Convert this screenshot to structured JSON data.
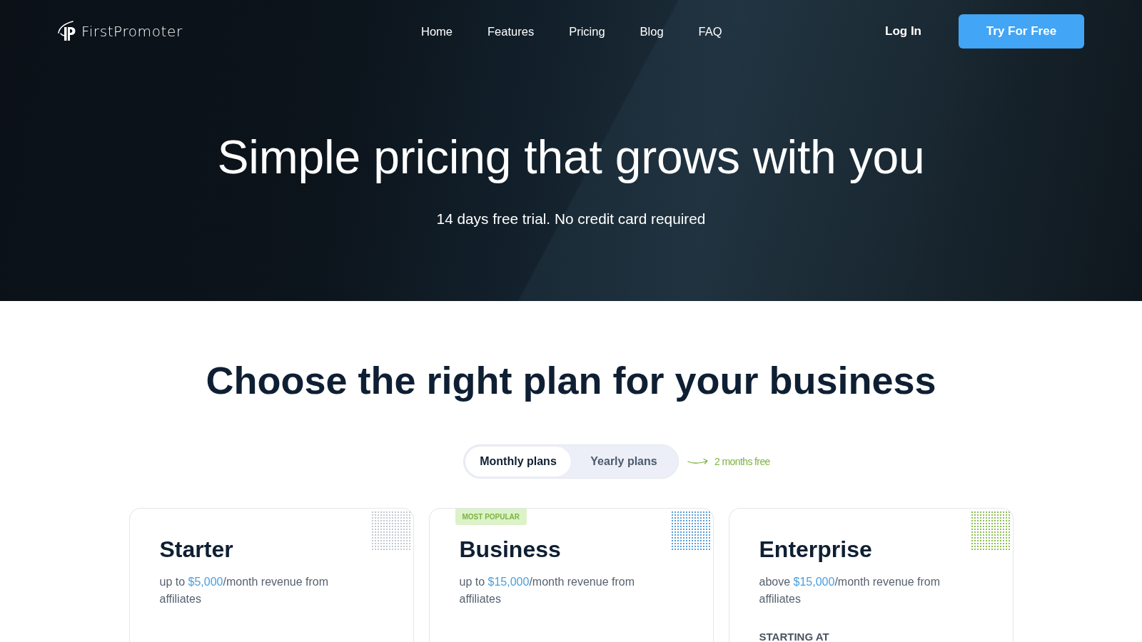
{
  "nav": {
    "logo": "FirstPromoter",
    "links": [
      "Home",
      "Features",
      "Pricing",
      "Blog",
      "FAQ"
    ],
    "login": "Log In",
    "cta": "Try For Free"
  },
  "hero": {
    "title": "Simple pricing that grows with you",
    "subtitle": "14 days free trial. No credit card required"
  },
  "plans_section": {
    "heading": "Choose the right plan for your business",
    "billing_toggle": {
      "options": [
        {
          "label": "Monthly plans",
          "selected": true
        },
        {
          "label": "Yearly plans",
          "selected": false
        }
      ],
      "note": "2 months free"
    },
    "plans": [
      {
        "name": "Starter",
        "color": "#c4c9d0",
        "description": {
          "before": "up to ",
          "amount": "$5,000",
          "after": "/month revenue from affiliates"
        }
      },
      {
        "name": "Business",
        "color": "#5b9fd8",
        "badge": "MOST POPULAR",
        "description": {
          "before": "up to ",
          "amount": "$15,000",
          "after": "/month revenue from affiliates"
        }
      },
      {
        "name": "Enterprise",
        "color": "#8cc152",
        "description": {
          "before": "above ",
          "amount": "$15,000",
          "after": "/month revenue from affiliates"
        },
        "price_label": "STARTING AT"
      }
    ]
  }
}
